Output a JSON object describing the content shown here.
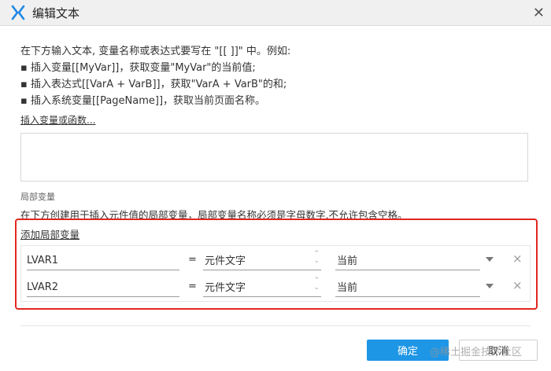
{
  "window": {
    "title": "编辑文本",
    "close_glyph": "✕"
  },
  "instructions": [
    "在下方输入文本, 变量名称或表达式要写在 \"[[ ]]\" 中。例如:",
    "▪ 插入变量[[MyVar]]，获取变量\"MyVar\"的当前值;",
    "▪ 插入表达式[[VarA + VarB]]，获取\"VarA + VarB\"的和;",
    "▪ 插入系统变量[[PageName]]，获取当前页面名称。"
  ],
  "insert_link": "插入变量或函数...",
  "local_vars": {
    "section_title": "局部变量",
    "description": "在下方创建用于插入元件值的局部变量，局部变量名称必须是字母数字,不允许包含空格。",
    "add_link": "添加局部变量",
    "rows": [
      {
        "name": "LVAR1",
        "eq": "=",
        "type": "元件文字",
        "target": "当前",
        "remove": "×"
      },
      {
        "name": "LVAR2",
        "eq": "=",
        "type": "元件文字",
        "target": "当前",
        "remove": "×"
      }
    ]
  },
  "buttons": {
    "ok": "确定",
    "cancel": "取消"
  },
  "watermark": "@稀土掘金技术社区",
  "colors": {
    "accent": "#1e96e6",
    "highlight_frame": "#e0281f",
    "logo": "#1e88e5"
  },
  "icons": {
    "app": "axure-x-logo",
    "spinner": "up-down-spinner-icon",
    "dropdown": "dropdown-caret-icon",
    "remove": "remove-icon"
  }
}
